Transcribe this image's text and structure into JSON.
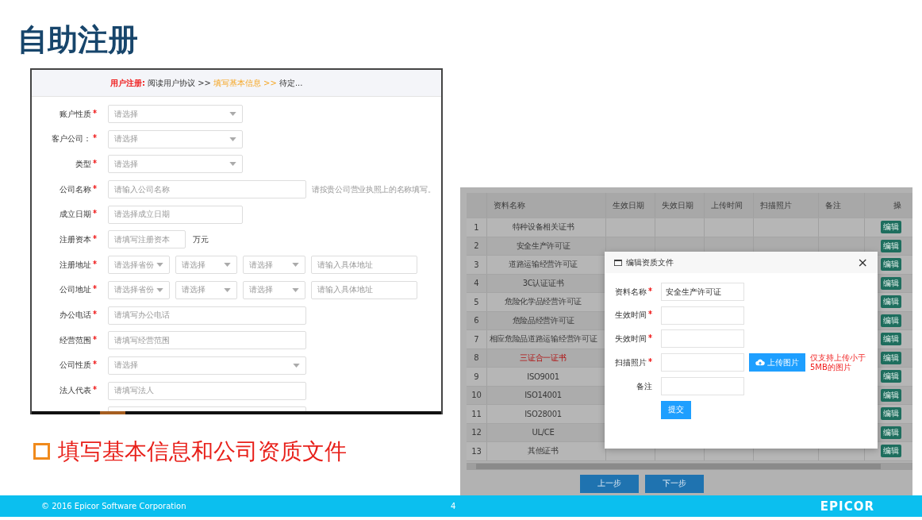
{
  "slide": {
    "title": "自助注册",
    "bullet": "填写基本信息和公司资质文件",
    "footer": {
      "copyright": "© 2016 Epicor Software Corporation",
      "page": "4",
      "logo": "EPICOR"
    }
  },
  "registration": {
    "breadcrumb": [
      {
        "text": "用户注册:",
        "kind": "lead"
      },
      {
        "text": "阅读用户协议 >>",
        "kind": "done"
      },
      {
        "text": "填写基本信息 >>",
        "kind": "current"
      },
      {
        "text": "待定...",
        "kind": "todo"
      }
    ],
    "rows": [
      {
        "label": "账户性质",
        "required": true,
        "fields": [
          {
            "kind": "select",
            "placeholder": "请选择"
          }
        ]
      },
      {
        "label": "客户公司：",
        "required": true,
        "fields": [
          {
            "kind": "select",
            "placeholder": "请选择"
          }
        ]
      },
      {
        "label": "类型",
        "required": true,
        "fields": [
          {
            "kind": "select",
            "placeholder": "请选择"
          }
        ]
      },
      {
        "label": "公司名称",
        "required": true,
        "fields": [
          {
            "kind": "input",
            "placeholder": "请输入公司名称"
          }
        ],
        "hint": "请按贵公司营业执照上的名称填写。"
      },
      {
        "label": "成立日期",
        "required": true,
        "fields": [
          {
            "kind": "input",
            "placeholder": "请选择成立日期"
          }
        ]
      },
      {
        "label": "注册资本",
        "required": true,
        "fields": [
          {
            "kind": "input",
            "placeholder": "请填写注册资本"
          }
        ],
        "unit": "万元"
      },
      {
        "label": "注册地址",
        "required": true,
        "fields": [
          {
            "kind": "select",
            "placeholder": "请选择省份"
          },
          {
            "kind": "select",
            "placeholder": "请选择"
          },
          {
            "kind": "select",
            "placeholder": "请选择"
          },
          {
            "kind": "input",
            "placeholder": "请输入具体地址"
          }
        ]
      },
      {
        "label": "公司地址",
        "required": true,
        "fields": [
          {
            "kind": "select",
            "placeholder": "请选择省份"
          },
          {
            "kind": "select",
            "placeholder": "请选择"
          },
          {
            "kind": "select",
            "placeholder": "请选择"
          },
          {
            "kind": "input",
            "placeholder": "请输入具体地址"
          }
        ]
      },
      {
        "label": "办公电话",
        "required": true,
        "fields": [
          {
            "kind": "input",
            "placeholder": "请填写办公电话"
          }
        ]
      },
      {
        "label": "经营范围",
        "required": true,
        "fields": [
          {
            "kind": "input",
            "placeholder": "请填写经营范围"
          }
        ]
      },
      {
        "label": "公司性质",
        "required": true,
        "fields": [
          {
            "kind": "select",
            "placeholder": "请选择"
          }
        ]
      },
      {
        "label": "法人代表",
        "required": true,
        "fields": [
          {
            "kind": "input",
            "placeholder": "请填写法人"
          }
        ]
      },
      {
        "required": false,
        "fields": [
          {
            "kind": "input"
          }
        ]
      }
    ]
  },
  "documents": {
    "columns": [
      "资料名称",
      "生效日期",
      "失效日期",
      "上传时间",
      "扫描照片",
      "备注",
      "操"
    ],
    "rows": [
      {
        "no": "1",
        "name": "特种设备相关证书",
        "emphasis": false,
        "action": "编辑"
      },
      {
        "no": "2",
        "name": "安全生产许可证",
        "emphasis": false,
        "action": "编辑"
      },
      {
        "no": "3",
        "name": "道路运输经营许可证",
        "emphasis": false,
        "action": "编辑"
      },
      {
        "no": "4",
        "name": "3C认证证书",
        "emphasis": false,
        "action": "编辑"
      },
      {
        "no": "5",
        "name": "危险化学品经营许可证",
        "emphasis": false,
        "action": "编辑"
      },
      {
        "no": "6",
        "name": "危险品经营许可证",
        "emphasis": false,
        "action": "编辑"
      },
      {
        "no": "7",
        "name": "相应危险品道路运输经营许可证",
        "emphasis": false,
        "action": "编辑"
      },
      {
        "no": "8",
        "name": "三证合一证书",
        "emphasis": true,
        "action": "编辑"
      },
      {
        "no": "9",
        "name": "ISO9001",
        "emphasis": false,
        "action": "编辑"
      },
      {
        "no": "10",
        "name": "ISO14001",
        "emphasis": false,
        "action": "编辑"
      },
      {
        "no": "11",
        "name": "ISO28001",
        "emphasis": false,
        "action": "编辑"
      },
      {
        "no": "12",
        "name": "UL/CE",
        "emphasis": false,
        "action": "编辑"
      },
      {
        "no": "13",
        "name": "其他证书",
        "emphasis": false,
        "action": "编辑"
      }
    ],
    "buttons": [
      "上一步",
      "下一步"
    ],
    "dialog": {
      "title": "编辑资质文件",
      "close": "×",
      "fields": [
        {
          "label": "资料名称",
          "required": true,
          "kind": "input",
          "value": "安全生产许可证"
        },
        {
          "label": "生效时间",
          "required": true,
          "kind": "input"
        },
        {
          "label": "失效时间",
          "required": true,
          "kind": "input"
        },
        {
          "label": "扫描照片",
          "required": true,
          "kind": "upload",
          "button": "上传图片",
          "hint": "仅支持上传小于5MB的图片"
        },
        {
          "label": "备注",
          "required": false,
          "kind": "input"
        }
      ],
      "submit": "提交"
    }
  }
}
